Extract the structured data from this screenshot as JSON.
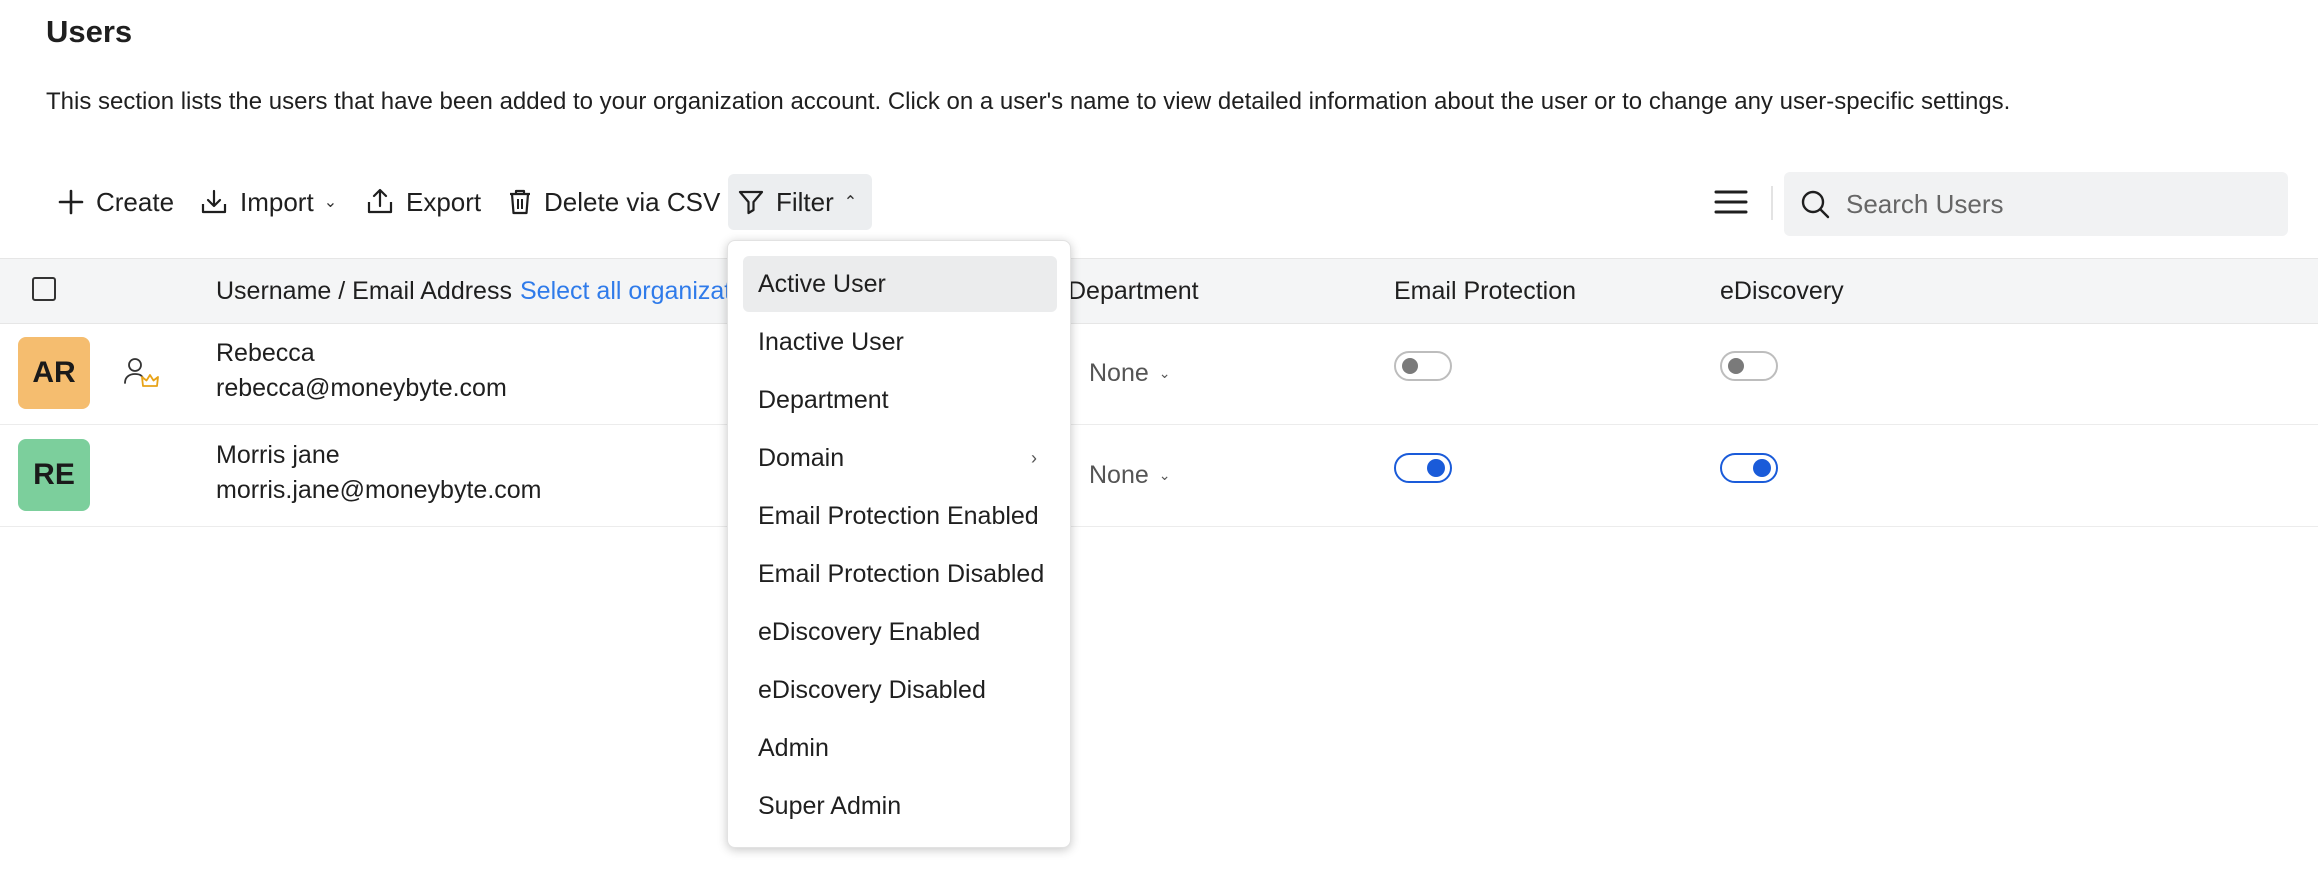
{
  "page": {
    "title": "Users",
    "description": "This section lists the users that have been added to your organization account. Click on a user's name to view detailed information about the user or to change any user-specific settings."
  },
  "toolbar": {
    "create_label": "Create",
    "import_label": "Import",
    "export_label": "Export",
    "delete_csv_label": "Delete via CSV",
    "filter_label": "Filter",
    "search_placeholder": "Search Users"
  },
  "table": {
    "headers": {
      "username": "Username / Email Address",
      "select_all": "Select all organizat",
      "department": "Department",
      "email_protection": "Email Protection",
      "ediscovery": "eDiscovery"
    },
    "rows": [
      {
        "initials": "AR",
        "avatar_color": "#f5bd6f",
        "has_admin_icon": true,
        "name": "Rebecca",
        "email": "rebecca@moneybyte.com",
        "department": "None",
        "email_protection": false,
        "ediscovery": false
      },
      {
        "initials": "RE",
        "avatar_color": "#7ccf9c",
        "has_admin_icon": false,
        "name": "Morris jane",
        "email": "morris.jane@moneybyte.com",
        "department": "None",
        "email_protection": true,
        "ediscovery": true
      }
    ]
  },
  "filter_menu": {
    "items": [
      {
        "label": "Active User",
        "highlighted": true
      },
      {
        "label": "Inactive User"
      },
      {
        "label": "Department"
      },
      {
        "label": "Domain",
        "has_submenu": true
      },
      {
        "label": "Email Protection Enabled"
      },
      {
        "label": "Email Protection Disabled"
      },
      {
        "label": "eDiscovery Enabled"
      },
      {
        "label": "eDiscovery Disabled"
      },
      {
        "label": "Admin"
      },
      {
        "label": "Super Admin"
      }
    ]
  },
  "colors": {
    "accent": "#1a5bd9",
    "link": "#2f7bea",
    "admin_icon": "#e8a317"
  }
}
